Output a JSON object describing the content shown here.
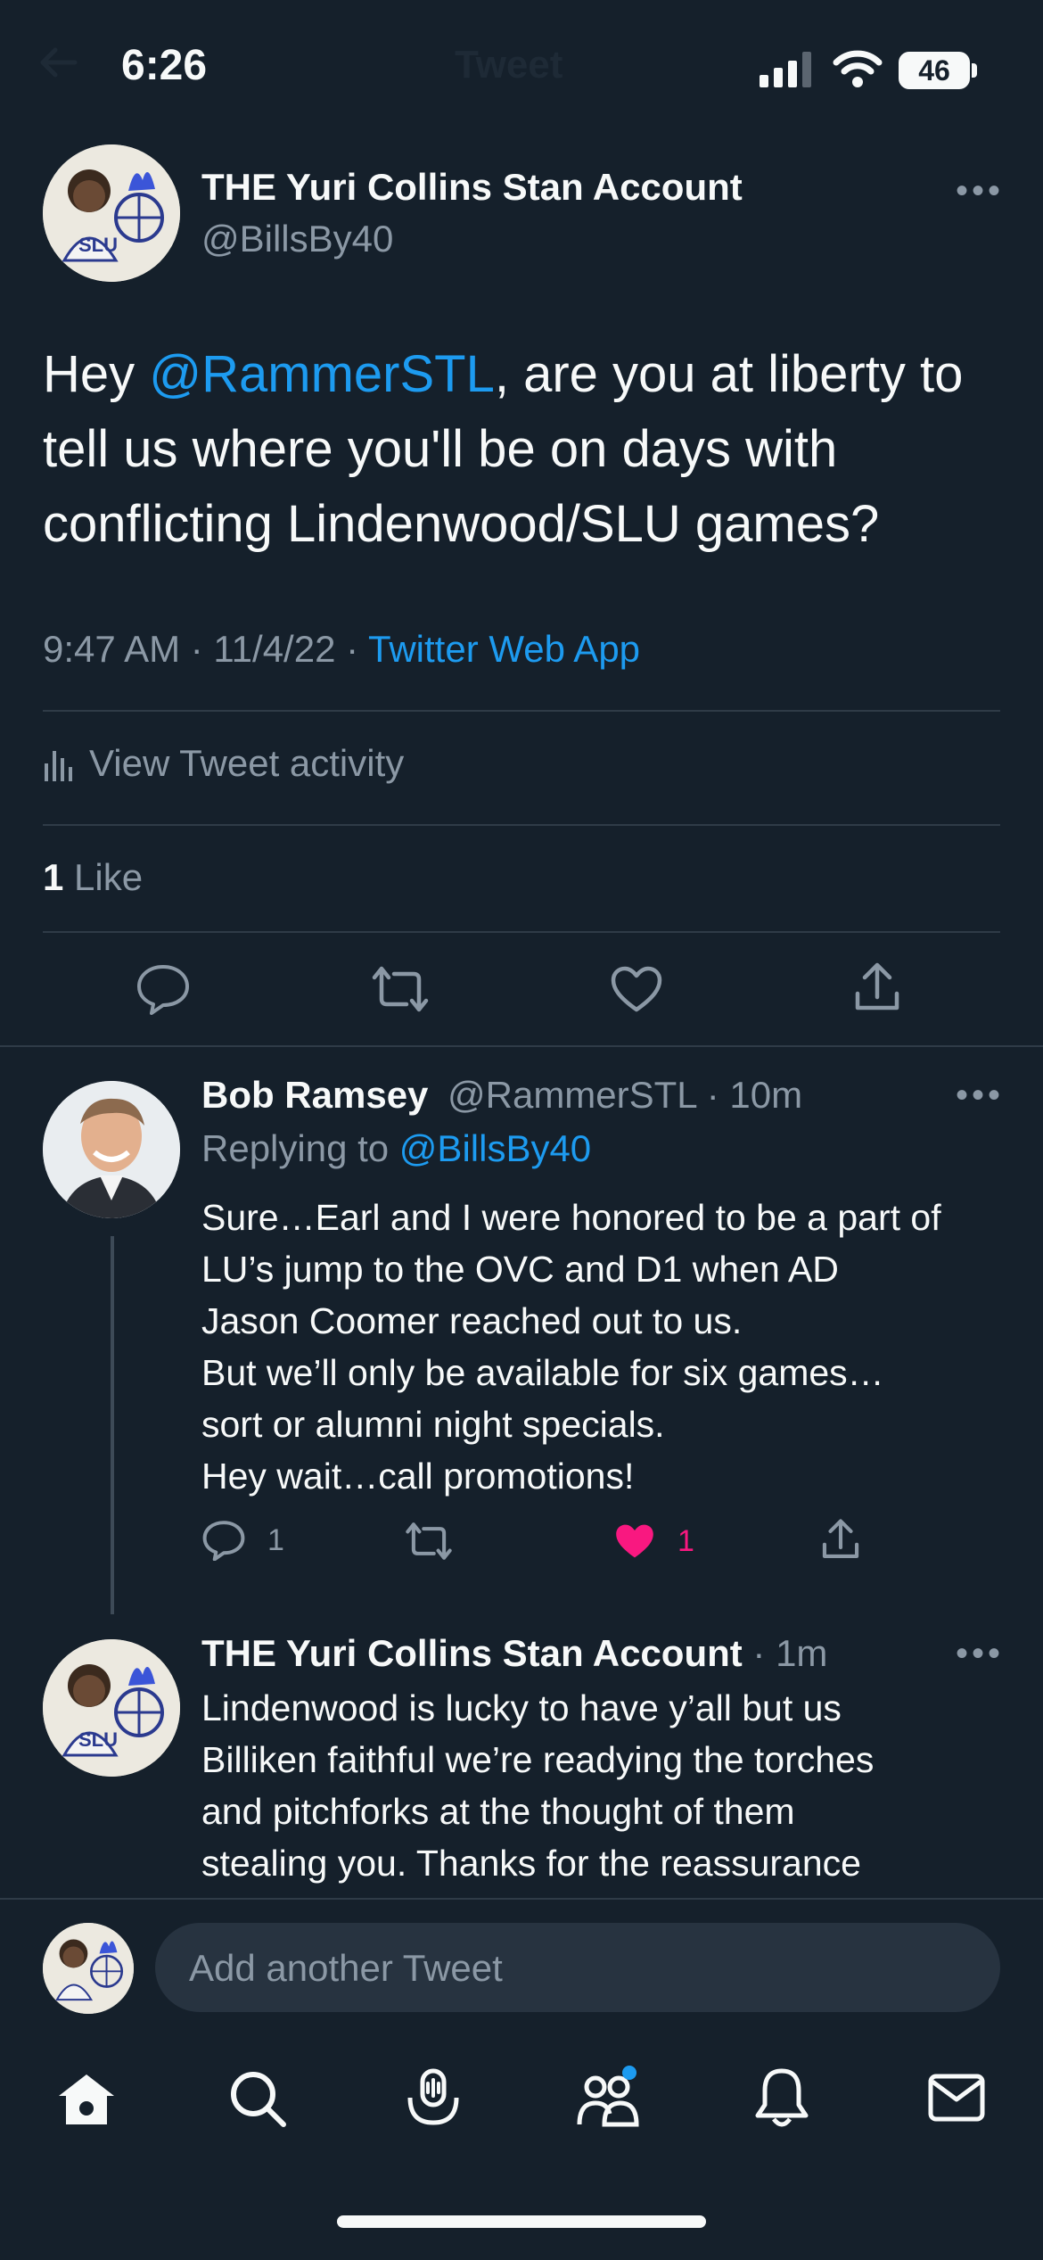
{
  "status_bar": {
    "time": "6:26",
    "battery": "46",
    "ghost_title": "Tweet"
  },
  "tweet": {
    "author_name": "THE Yuri Collins Stan Account",
    "author_handle": "@BillsBy40",
    "text_before": "Hey ",
    "mention": "@RammerSTL",
    "text_after": ", are you at liberty to tell us where you'll be on days with conflicting Lindenwood/SLU games?",
    "meta_time": "9:47 AM · 11/4/22 · ",
    "source": "Twitter Web App",
    "activity_label": "View Tweet activity",
    "like_count": "1",
    "like_label": " Like"
  },
  "replies": [
    {
      "name": "Bob Ramsey",
      "handle_time": "@RammerSTL · 10m",
      "replying_prefix": "Replying to ",
      "replying_handle": "@BillsBy40",
      "lines": [
        "Sure…Earl and I were honored to be a part of",
        "LU’s jump to the OVC and D1 when AD",
        "Jason Coomer reached out to us.",
        "But we’ll only be available for six games…",
        "sort or alumni night specials.",
        "Hey wait…call promotions!"
      ],
      "reply_count": "1",
      "like_count": "1"
    },
    {
      "name": "THE Yuri Collins Stan Account",
      "time": " · 1m",
      "lines": [
        "Lindenwood is lucky to have y’all but us",
        "Billiken faithful we’re readying the torches",
        "and pitchforks at the thought of them",
        "stealing you. Thanks for the reassurance"
      ]
    }
  ],
  "composer": {
    "placeholder": "Add another Tweet"
  },
  "tab_bar": {
    "items": [
      "home-icon",
      "search-icon",
      "spaces-icon",
      "communities-icon",
      "notifications-icon",
      "messages-icon"
    ]
  },
  "colors": {
    "background": "#15202b",
    "accent": "#1d9bf0",
    "like": "#f91880",
    "muted": "#8b98a5"
  }
}
